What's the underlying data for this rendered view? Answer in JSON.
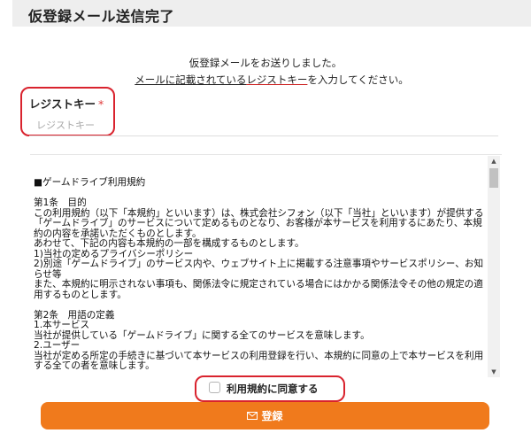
{
  "header": {
    "title": "仮登録メール送信完了"
  },
  "message": {
    "line1": "仮登録メールをお送りしました。",
    "line2_link": "メールに記載されている",
    "line2_red": "レジストキー",
    "line2_tail": "を入力してください。"
  },
  "key_field": {
    "label": "レジストキー",
    "required_mark": "*",
    "placeholder": "レジストキー"
  },
  "terms": {
    "text": "■ゲームドライブ利用規約\n\n第1条　目的\nこの利用規約（以下「本規約」といいます）は、株式会社シフォン（以下「当社」といいます）が提供する「ゲームドライブ」のサービスについて定めるものとなり、お客様が本サービスを利用するにあたり、本規約の内容を承諾いただくものとします。\nあわせて、下記の内容も本規約の一部を構成するものとします。\n1)当社の定めるプライバシーポリシー\n2)別途「ゲームドライブ」のサービス内や、ウェブサイト上に掲載する注意事項やサービスポリシー、お知らせ等\nまた、本規約に明示されない事項も、関係法令に規定されている場合にはかかる関係法令その他の規定の適用するものとします。\n\n第2条　用語の定義\n1.本サービス\n当社が提供している「ゲームドライブ」に関する全てのサービスを意味します。\n2.ユーザー\n当社が定める所定の手続きに基づいて本サービスの利用登録を行い、本規約に同意の上で本サービスを利用する全ての者を意味します。"
  },
  "agree": {
    "label": "利用規約に同意する",
    "checked": false
  },
  "submit": {
    "label": "登録"
  },
  "colors": {
    "accent": "#f07a1c",
    "annotation": "#d9232e"
  }
}
